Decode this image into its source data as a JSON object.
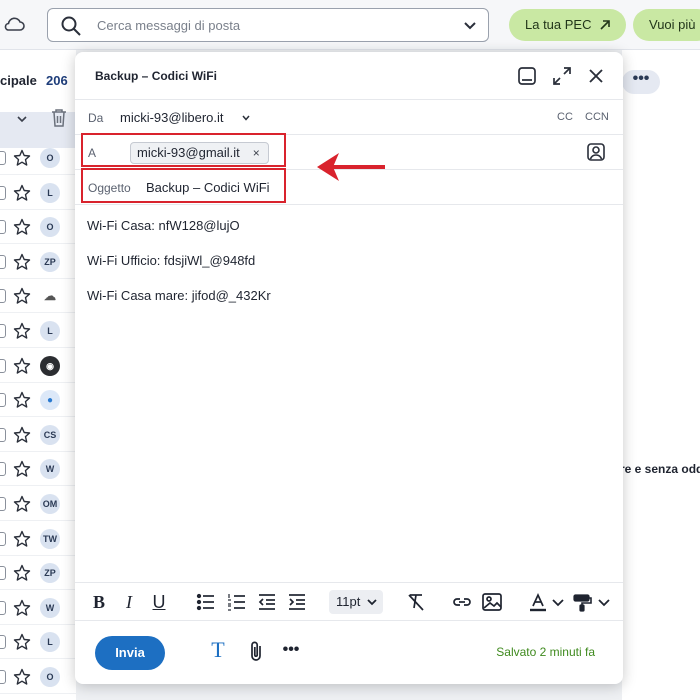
{
  "search": {
    "placeholder": "Cerca messaggi di posta"
  },
  "header_buttons": {
    "pec": "La tua PEC",
    "more": "Vuoi più"
  },
  "folder": {
    "name": "cipale",
    "count": "206"
  },
  "list_rows": [
    {
      "initials": "O",
      "style": "light"
    },
    {
      "initials": "L",
      "style": "light"
    },
    {
      "initials": "O",
      "style": "light"
    },
    {
      "initials": "ZP",
      "style": "light"
    },
    {
      "initials": "",
      "style": "icon"
    },
    {
      "initials": "L",
      "style": "light"
    },
    {
      "initials": "",
      "style": "dark"
    },
    {
      "initials": "",
      "style": "blue"
    },
    {
      "initials": "CS",
      "style": "light"
    },
    {
      "initials": "W",
      "style": "light"
    },
    {
      "initials": "OM",
      "style": "light"
    },
    {
      "initials": "TW",
      "style": "light"
    },
    {
      "initials": "ZP",
      "style": "light"
    },
    {
      "initials": "W",
      "style": "light"
    },
    {
      "initials": "L",
      "style": "light"
    },
    {
      "initials": "O",
      "style": "light"
    }
  ],
  "right_peek": {
    "dots": "•••",
    "text": "re e senza odd"
  },
  "compose": {
    "title": "Backup – Codici WiFi",
    "from_label": "Da",
    "from_value": "micki-93@libero.it",
    "cc": "CC",
    "bcc": "CCN",
    "to_label": "A",
    "to_chip": "micki-93@gmail.it",
    "to_chip_remove": "×",
    "subject_label": "Oggetto",
    "subject_value": "Backup – Codici WiFi",
    "body_lines": [
      "Wi-Fi Casa: nfW128@lujO",
      "Wi-Fi Ufficio: fdsjiWl_@948fd",
      "Wi-Fi Casa mare: jifod@_432Kr"
    ],
    "font_size": "11pt",
    "send_label": "Invia",
    "saved_status": "Salvato 2 minuti fa"
  },
  "colors": {
    "accent": "#1d6fc2",
    "highlight": "#d9232d",
    "saved": "#3f8a1e",
    "pec_bg": "#c9e8a3"
  }
}
